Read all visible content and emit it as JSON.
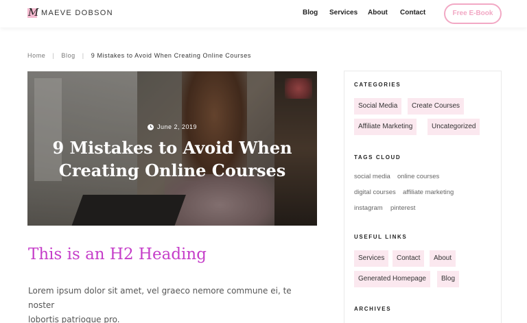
{
  "header": {
    "logo_text": "MAEVE DOBSON",
    "logo_mark": "M",
    "nav": [
      "Blog",
      "Services",
      "About",
      "Contact"
    ],
    "cta": "Free E-Book"
  },
  "breadcrumb": {
    "items": [
      "Home",
      "Blog"
    ],
    "current": "9 Mistakes to Avoid When Creating Online Courses"
  },
  "hero": {
    "date": "June 2, 2019",
    "title_line1": "9 Mistakes to Avoid When",
    "title_line2": "Creating Online Courses",
    "icon": "clock-icon"
  },
  "content": {
    "h2": "This is an H2 Heading",
    "para_line1": "Lorem ipsum dolor sit amet, vel graeco nemore commune ei, te noster",
    "para_line2": "lobortis patrioque pro."
  },
  "sidebar": {
    "categories_title": "CATEGORIES",
    "categories": [
      "Social Media",
      "Create Courses",
      "Affiliate Marketing",
      "Uncategorized"
    ],
    "tags_title": "TAGS CLOUD",
    "tags": [
      "social media",
      "online courses",
      "digital courses",
      "affiliate marketing",
      "instagram",
      "pinterest"
    ],
    "links_title": "USEFUL LINKS",
    "links": [
      "Services",
      "Contact",
      "About",
      "Generated Homepage",
      "Blog"
    ],
    "archives_title": "ARCHIVES"
  },
  "colors": {
    "accent_pink": "#f2a8c4",
    "chip_bg": "#fbe8ef",
    "heading_purple": "#c53ec9"
  }
}
